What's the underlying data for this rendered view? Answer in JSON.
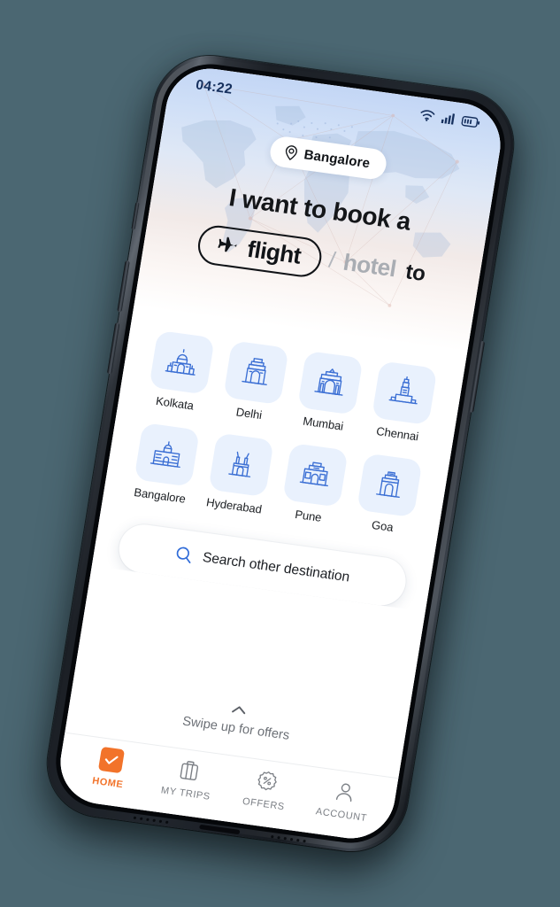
{
  "background_color": "#4b6772",
  "device": {
    "name": "smartphone-mockup",
    "frame_color": "#21262d"
  },
  "status_bar": {
    "time": "04:22",
    "icons": [
      "wifi-icon",
      "cellular-signal-icon",
      "battery-icon"
    ],
    "text_color": "#16305e"
  },
  "location_pill": {
    "icon": "map-pin-icon",
    "label": "Bangalore"
  },
  "hero": {
    "headline": "I want to book a",
    "selected_option": {
      "icon": "airplane-icon",
      "label": "flight"
    },
    "separator": "/",
    "alternate_option": "hotel",
    "trailing_word": "to",
    "gradient_top": "#c3d6f5",
    "gradient_bottom": "#ffffff"
  },
  "cities": [
    {
      "name": "Kolkata",
      "icon": "victoria-memorial-icon"
    },
    {
      "name": "Delhi",
      "icon": "india-gate-icon"
    },
    {
      "name": "Mumbai",
      "icon": "gateway-of-india-icon"
    },
    {
      "name": "Chennai",
      "icon": "lighthouse-tower-icon"
    },
    {
      "name": "Bangalore",
      "icon": "vidhana-soudha-icon"
    },
    {
      "name": "Hyderabad",
      "icon": "charminar-icon"
    },
    {
      "name": "Pune",
      "icon": "shaniwar-wada-icon"
    },
    {
      "name": "Goa",
      "icon": "arch-monument-icon"
    }
  ],
  "city_tile": {
    "background": "#e9f1fd",
    "icon_color": "#3b6fd4"
  },
  "search": {
    "icon": "search-icon",
    "label": "Search other destination",
    "icon_color": "#2f6bd8"
  },
  "swipe": {
    "icon": "chevron-up-icon",
    "label": "Swipe up for offers"
  },
  "tabbar": {
    "active_color": "#f2732a",
    "inactive_color": "#7b7f85",
    "items": [
      {
        "label": "HOME",
        "icon": "home-check-icon",
        "active": true
      },
      {
        "label": "MY TRIPS",
        "icon": "suitcase-icon",
        "active": false
      },
      {
        "label": "OFFERS",
        "icon": "discount-tag-icon",
        "active": false
      },
      {
        "label": "ACCOUNT",
        "icon": "person-icon",
        "active": false
      }
    ]
  }
}
